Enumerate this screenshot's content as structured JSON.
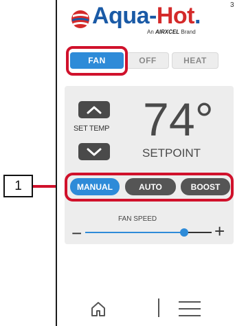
{
  "callout": {
    "number": "1"
  },
  "page_marker": "3",
  "logo": {
    "brand_primary": "Aqua-",
    "brand_secondary": "Hot",
    "trademark": ".",
    "tagline_prefix": "An ",
    "tagline_brand": "AIRXCEL",
    "tagline_suffix": " Brand"
  },
  "mode": {
    "fan": "FAN",
    "off": "OFF",
    "heat": "HEAT",
    "selected": "FAN"
  },
  "thermostat": {
    "set_temp_label": "SET TEMP",
    "temperature": "74°",
    "setpoint_label": "SETPOINT"
  },
  "fan_mode": {
    "manual": "MANUAL",
    "auto": "AUTO",
    "boost": "BOOST",
    "selected": "MANUAL"
  },
  "fan_speed": {
    "label": "FAN SPEED",
    "minus": "−",
    "plus": "+",
    "level": 0.78
  },
  "nav": {
    "home_icon": "home-icon",
    "menu_icon": "menu-icon"
  },
  "colors": {
    "accent": "#2e8bd8",
    "highlight": "#d0112b",
    "button_dark": "#555555",
    "panel": "#ededed"
  }
}
